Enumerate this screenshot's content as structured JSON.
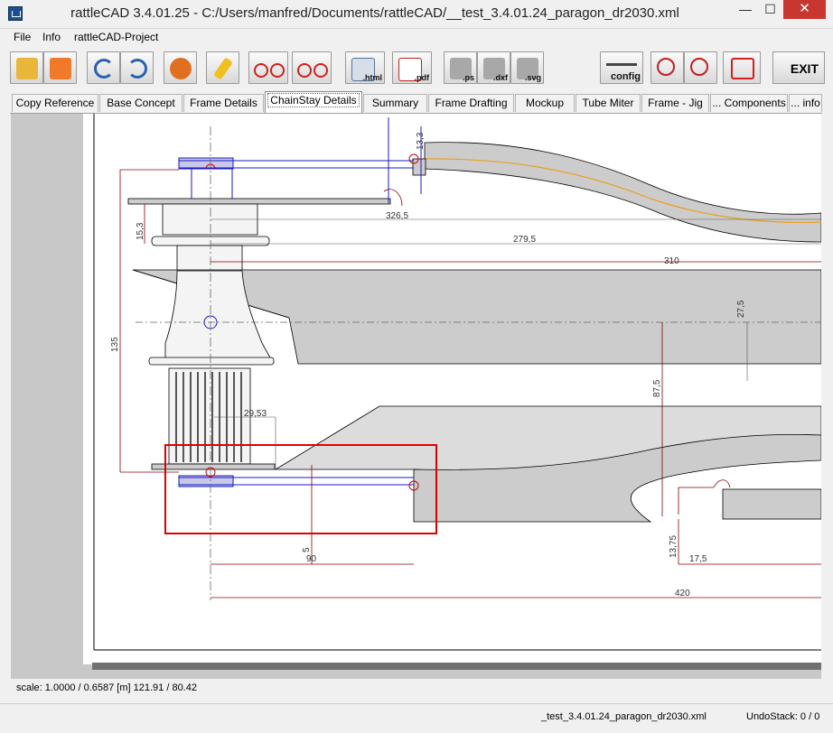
{
  "window": {
    "title": "rattleCAD  3.4.01.25 - C:/Users/manfred/Documents/rattleCAD/__test_3.4.01.24_paragon_dr2030.xml",
    "minimize": "—",
    "maximize": "☐",
    "close": "✕"
  },
  "menu": [
    "File",
    "Info",
    "rattleCAD-Project"
  ],
  "toolbar": {
    "html_label": ".html",
    "pdf_label": ".pdf",
    "ps_label": ".ps",
    "dxf_label": ".dxf",
    "svg_label": ".svg",
    "config_label": "config",
    "exit_label": "EXIT"
  },
  "tabs": [
    "Copy Reference",
    "Base Concept",
    "Frame Details",
    "ChainStay Details",
    "Summary",
    "Frame Drafting",
    "Mockup",
    "Tube Miter",
    "Frame - Jig",
    "... Components",
    "... info"
  ],
  "active_tab": "ChainStay Details",
  "dimensions": {
    "d_326_5": "326,5",
    "d_279_5": "279,5",
    "d_310": "310",
    "d_27_5": "27,5",
    "d_87_5": "87,5",
    "d_135": "135",
    "d_15_3": "15,3",
    "d_13_3": "13,3",
    "d_29_53": "29,53",
    "d_5": "5",
    "d_90": "90",
    "d_13_75": "13,75",
    "d_17_5": "17,5",
    "d_420": "420"
  },
  "status": {
    "scale_line": "scale: 1.0000 / 0.6587  [m]  121.91 / 80.42",
    "file": "_test_3.4.01.24_paragon_dr2030.xml",
    "undo": "UndoStack:  0 / 0"
  },
  "colors": {
    "accent_red": "#d00000",
    "guide_blue": "#1a1ac8",
    "chainstay_orange": "#e8a020",
    "tube_gray": "#cccccc"
  }
}
